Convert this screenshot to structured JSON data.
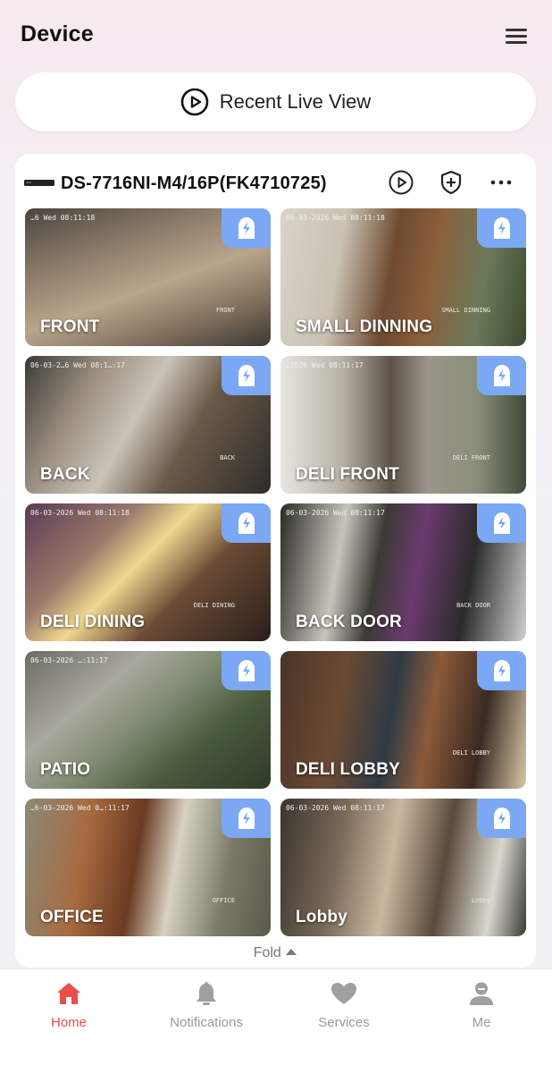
{
  "header": {
    "title": "Device",
    "menu_icon": "hamburger-menu-icon"
  },
  "recent_live_view": {
    "label": "Recent Live View",
    "icon": "play-circle-icon"
  },
  "device": {
    "name": "DS-7716NI-M4/16P(FK4710725)",
    "icon": "nvr-device-icon",
    "actions": [
      "play-circle-icon",
      "shield-plus-icon",
      "more-icon"
    ]
  },
  "cameras": [
    {
      "name": "FRONT",
      "timestamp": "…6 Wed 08:11:18",
      "watermark": "FRONT"
    },
    {
      "name": "SMALL DINNING",
      "timestamp": "06-03-2026 Wed 08:11:18",
      "watermark": "SMALL DINNING"
    },
    {
      "name": "BACK",
      "timestamp": "06-03-2…6 Wed 08:1…:17",
      "watermark": "BACK"
    },
    {
      "name": "DELI FRONT",
      "timestamp": "…2026 Wed 08:11:17",
      "watermark": "DELI FRONT"
    },
    {
      "name": "DELI DINING",
      "timestamp": "06-03-2026 Wed 08:11:18",
      "watermark": "DELI DINING"
    },
    {
      "name": "BACK DOOR",
      "timestamp": "06-03-2026 Wed 08:11:17",
      "watermark": "BACK DOOR"
    },
    {
      "name": "PATIO",
      "timestamp": "06-03-2026 …:11:17",
      "watermark": ""
    },
    {
      "name": "DELI LOBBY",
      "timestamp": "",
      "watermark": "DELI LOBBY"
    },
    {
      "name": "OFFICE",
      "timestamp": "…6-03-2026 Wed 0…:11:17",
      "watermark": "OFFICE"
    },
    {
      "name": "Lobby",
      "timestamp": "06-03-2026 Wed 08:11:17",
      "watermark": "Lobby"
    }
  ],
  "fold": {
    "label": "Fold",
    "icon": "triangle-up-icon"
  },
  "tabs": [
    {
      "label": "Home",
      "icon": "home-icon",
      "active": true
    },
    {
      "label": "Notifications",
      "icon": "bell-icon",
      "active": false
    },
    {
      "label": "Services",
      "icon": "heart-icon",
      "active": false
    },
    {
      "label": "Me",
      "icon": "user-icon",
      "active": false
    }
  ],
  "colors": {
    "accent": "#e8514a",
    "badge": "#7aa8f5",
    "tab_inactive": "#9a9a9a"
  }
}
